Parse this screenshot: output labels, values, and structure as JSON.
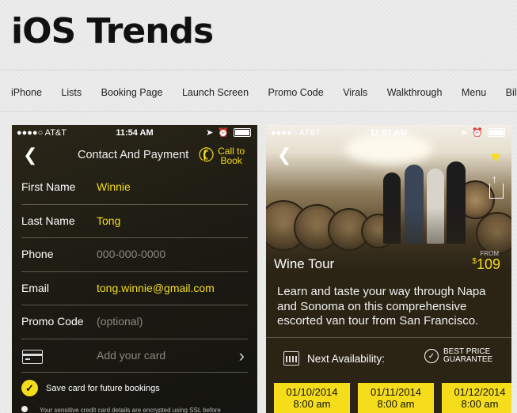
{
  "site": {
    "title": "iOS Trends",
    "nav": [
      "iPhone",
      "Lists",
      "Booking Page",
      "Launch Screen",
      "Promo Code",
      "Virals",
      "Walkthrough",
      "Menu",
      "Billing"
    ]
  },
  "phone1": {
    "status": {
      "carrier": "●●●●○ AT&T",
      "time": "11:54 AM"
    },
    "header_title": "Contact And Payment",
    "call_label": "Call to\nBook",
    "rows": [
      {
        "label": "First Name",
        "value": "Winnie"
      },
      {
        "label": "Last Name",
        "value": "Tong"
      },
      {
        "label": "Phone",
        "value": "000-000-0000"
      },
      {
        "label": "Email",
        "value": "tong.winnie@gmail.com"
      },
      {
        "label": "Promo Code",
        "value": "(optional)"
      }
    ],
    "card_placeholder": "Add your card",
    "save_label": "Save card for future bookings",
    "fine_print": "Your sensitive credit card details are encrypted using SSL before"
  },
  "phone2": {
    "status": {
      "carrier": "●●●●○ AT&T",
      "time": "11:51 AM"
    },
    "tour_title": "Wine Tour",
    "price_from": "FROM",
    "price_currency": "$",
    "price_value": "109",
    "description": "Learn and taste your way through Napa and Sonoma on this comprehensive escorted van tour from San Francisco.",
    "availability_label": "Next Availability:",
    "best_price": "BEST PRICE\nGUARANTEE",
    "slots": [
      {
        "date": "01/10/2014",
        "time": "8:00 am"
      },
      {
        "date": "01/11/2014",
        "time": "8:00 am"
      },
      {
        "date": "01/12/2014",
        "time": "8:00 am"
      }
    ]
  }
}
